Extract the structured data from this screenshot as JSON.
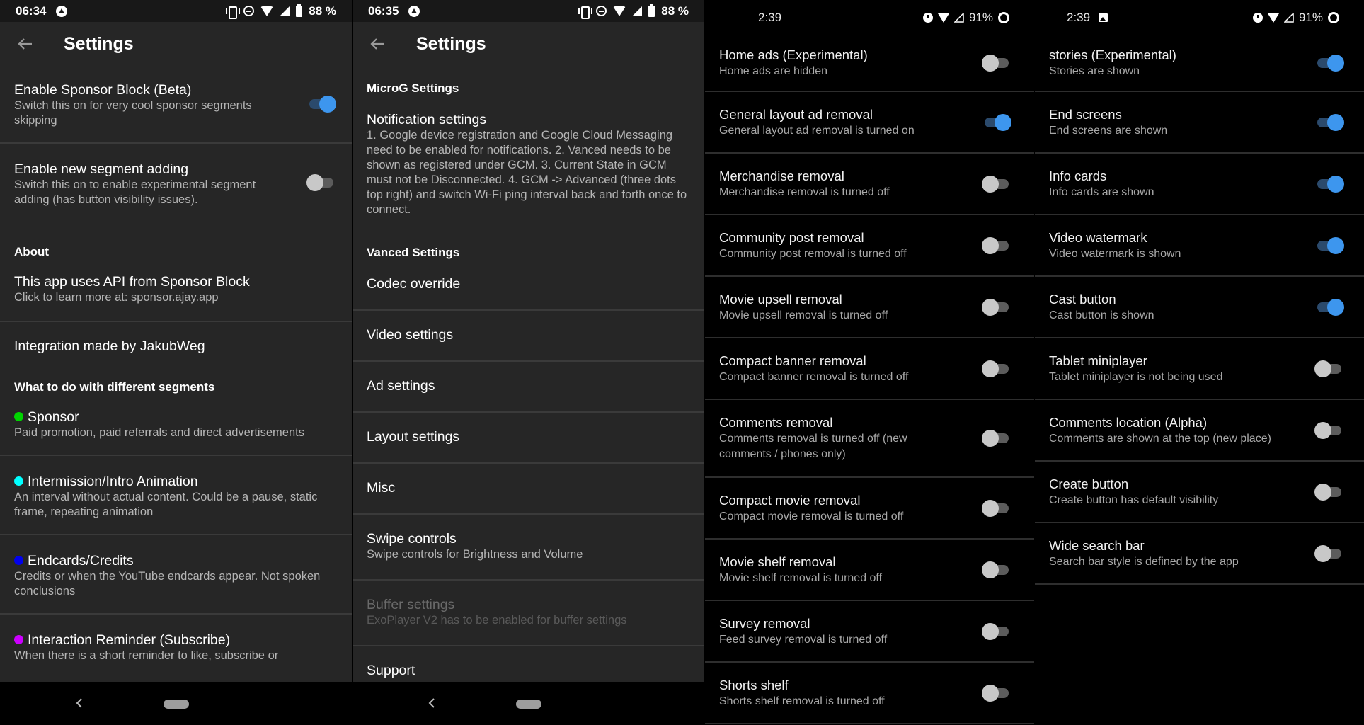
{
  "panel1": {
    "status_bar": {
      "time": "06:34",
      "battery": "88 %"
    },
    "toolbar": {
      "title": "Settings"
    },
    "items": [
      {
        "title": "Enable Sponsor Block (Beta)",
        "summary": "Switch this on for very cool sponsor segments skipping",
        "toggle": true
      },
      {
        "title": "Enable new segment adding",
        "summary": "Switch this on to enable experimental segment adding (has button visibility issues).",
        "toggle": false
      }
    ],
    "about": {
      "header": "About",
      "api_title": "This app uses API from Sponsor Block",
      "api_summary": "Click to learn more at: sponsor.ajay.app",
      "integration": "Integration made by JakubWeg"
    },
    "segments": {
      "header": "What to do with different segments",
      "items": [
        {
          "title": "Sponsor",
          "summary": "Paid promotion, paid referrals and direct advertisements",
          "color": "#00d400"
        },
        {
          "title": "Intermission/Intro Animation",
          "summary": "An interval without actual content. Could be a pause, static frame, repeating animation",
          "color": "#00ffff"
        },
        {
          "title": "Endcards/Credits",
          "summary": "Credits or when the YouTube endcards appear. Not spoken conclusions",
          "color": "#0202ed"
        },
        {
          "title": "Interaction Reminder (Subscribe)",
          "summary": "When there is a short reminder to like, subscribe or",
          "color": "#cc00ff"
        }
      ]
    }
  },
  "panel2": {
    "status_bar": {
      "time": "06:35",
      "battery": "88 %"
    },
    "toolbar": {
      "title": "Settings"
    },
    "microg": {
      "header": "MicroG Settings",
      "notification_title": "Notification settings",
      "notification_summary": "1. Google device registration and Google Cloud Messaging need to be enabled for notifications. 2. Vanced needs to be shown as registered under GCM. 3. Current State in GCM must not be Disconnected. 4. GCM -> Advanced (three dots top right) and switch Wi-Fi ping interval back and forth once to connect."
    },
    "vanced": {
      "header": "Vanced Settings",
      "items": [
        {
          "title": "Codec override"
        },
        {
          "title": "Video settings"
        },
        {
          "title": "Ad settings"
        },
        {
          "title": "Layout settings"
        },
        {
          "title": "Misc"
        },
        {
          "title": "Swipe controls",
          "summary": "Swipe controls for Brightness and Volume"
        },
        {
          "title": "Buffer settings",
          "summary": "ExoPlayer V2 has to be enabled for buffer settings",
          "disabled": true
        },
        {
          "title": "Support"
        }
      ]
    }
  },
  "panel3": {
    "status_bar": {
      "time": "2:39",
      "battery": "91%"
    },
    "items": [
      {
        "title": "Home ads (Experimental)",
        "summary": "Home ads are hidden",
        "toggle": false
      },
      {
        "title": "General layout ad removal",
        "summary": "General layout ad removal is turned on",
        "toggle": true
      },
      {
        "title": "Merchandise removal",
        "summary": "Merchandise removal is turned off",
        "toggle": false
      },
      {
        "title": "Community post removal",
        "summary": "Community post removal is turned off",
        "toggle": false
      },
      {
        "title": "Movie upsell removal",
        "summary": "Movie upsell removal is turned off",
        "toggle": false
      },
      {
        "title": "Compact banner removal",
        "summary": "Compact banner removal is turned off",
        "toggle": false
      },
      {
        "title": "Comments removal",
        "summary": "Comments removal is turned off (new comments / phones only)",
        "toggle": false
      },
      {
        "title": "Compact movie removal",
        "summary": "Compact movie removal is turned off",
        "toggle": false
      },
      {
        "title": "Movie shelf removal",
        "summary": "Movie shelf removal is turned off",
        "toggle": false
      },
      {
        "title": "Survey removal",
        "summary": "Feed survey removal is turned off",
        "toggle": false
      },
      {
        "title": "Shorts shelf",
        "summary": "Shorts shelf removal is turned off",
        "toggle": false
      }
    ]
  },
  "panel4": {
    "status_bar": {
      "time": "2:39",
      "battery": "91%"
    },
    "items": [
      {
        "title": "stories (Experimental)",
        "summary": "Stories are shown",
        "toggle": true
      },
      {
        "title": "End screens",
        "summary": "End screens are shown",
        "toggle": true
      },
      {
        "title": "Info cards",
        "summary": "Info cards are shown",
        "toggle": true
      },
      {
        "title": "Video watermark",
        "summary": "Video watermark is shown",
        "toggle": true
      },
      {
        "title": "Cast button",
        "summary": "Cast button is shown",
        "toggle": true
      },
      {
        "title": "Tablet miniplayer",
        "summary": "Tablet miniplayer is not being used",
        "toggle": false
      },
      {
        "title": "Comments location (Alpha)",
        "summary": "Comments are shown at the top (new place)",
        "toggle": false
      },
      {
        "title": "Create button",
        "summary": "Create button has default visibility",
        "toggle": false
      },
      {
        "title": "Wide search bar",
        "summary": "Search bar style is defined by the app",
        "toggle": false
      }
    ]
  },
  "colors": {
    "accent": "#3d96ee",
    "panel_bg": "#262626",
    "black_bg": "#000000"
  }
}
